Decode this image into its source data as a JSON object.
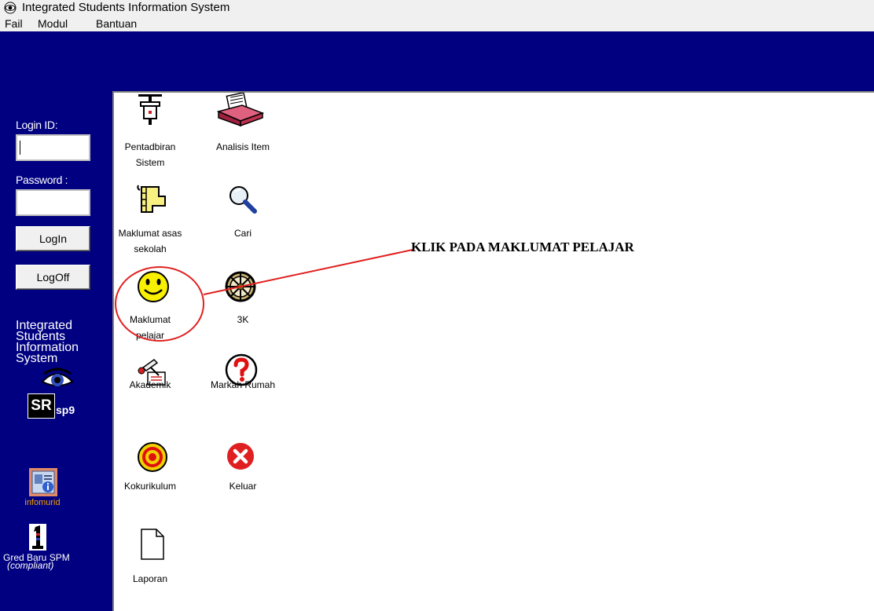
{
  "window": {
    "title": "Integrated Students Information System"
  },
  "menu": {
    "file": "Fail",
    "module": "Modul",
    "help": "Bantuan"
  },
  "login": {
    "id_label": "Login ID:",
    "password_label": "Password :",
    "login_button": "LogIn",
    "logoff_button": "LogOff"
  },
  "branding": {
    "line1": "Integrated",
    "line2": "Students",
    "line3": "Information",
    "line4": "System",
    "logo_big": "SR",
    "logo_small": "sp9"
  },
  "sidebar_apps": [
    {
      "label": "infomurid",
      "icon": "infomurid-icon"
    },
    {
      "label": "Gred Baru SPM",
      "sublabel": "(compliant)",
      "icon": "gred-spm-icon"
    }
  ],
  "modules": [
    {
      "line1": "Pentadbiran",
      "line2": "Sistem",
      "icon": "admin-icon"
    },
    {
      "line1": "Analisis Item",
      "line2": "",
      "icon": "analysis-icon"
    },
    {
      "line1": "Maklumat asas",
      "line2": "sekolah",
      "icon": "school-info-icon"
    },
    {
      "line1": "Cari",
      "line2": "",
      "icon": "search-icon"
    },
    {
      "line1": "Maklumat",
      "line2": "pelajar",
      "icon": "smiley-icon"
    },
    {
      "line1": "3K",
      "line2": "",
      "icon": "wheel-icon"
    },
    {
      "line1": "Akademik",
      "line2": "",
      "icon": "academic-icon"
    },
    {
      "line1": "Markah Rumah",
      "line2": "",
      "icon": "question-icon"
    },
    {
      "line1": "Kokurikulum",
      "line2": "",
      "icon": "target-icon"
    },
    {
      "line1": "Keluar",
      "line2": "",
      "icon": "exit-icon"
    },
    {
      "line1": "Laporan",
      "line2": "",
      "icon": "document-icon"
    }
  ],
  "annotation": {
    "text": "KLIK PADA MAKLUMAT PELAJAR"
  },
  "colors": {
    "sidebar": "#000080",
    "annotation": "#e02020",
    "chrome": "#f0f0f0"
  }
}
